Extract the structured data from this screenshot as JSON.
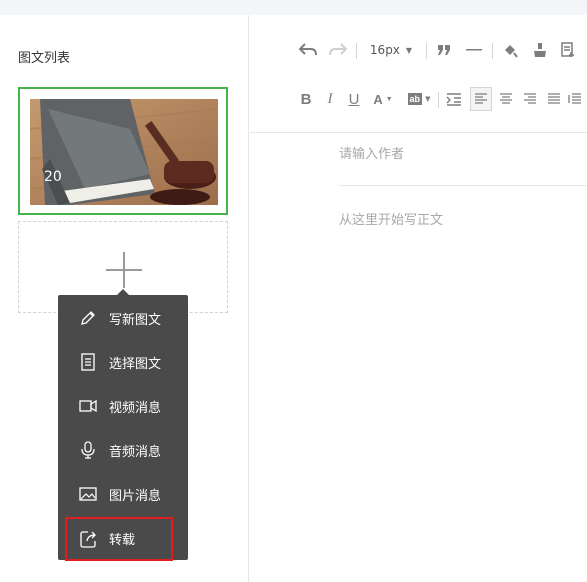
{
  "left_panel": {
    "title": "图文列表",
    "article": {
      "count": "20"
    }
  },
  "menu": {
    "items": [
      {
        "label": "写新图文",
        "icon": "pencil-icon"
      },
      {
        "label": "选择图文",
        "icon": "document-icon"
      },
      {
        "label": "视频消息",
        "icon": "video-camera-icon"
      },
      {
        "label": "音频消息",
        "icon": "microphone-icon"
      },
      {
        "label": "图片消息",
        "icon": "image-icon"
      },
      {
        "label": "转载",
        "icon": "share-icon",
        "highlighted": true
      }
    ]
  },
  "editor": {
    "font_size": "16px",
    "author_placeholder": "请输入作者",
    "body_placeholder": "从这里开始写正文"
  },
  "colors": {
    "accent_green": "#44b549",
    "menu_background": "#4a4a4a",
    "highlight_red": "#e01e1e"
  }
}
